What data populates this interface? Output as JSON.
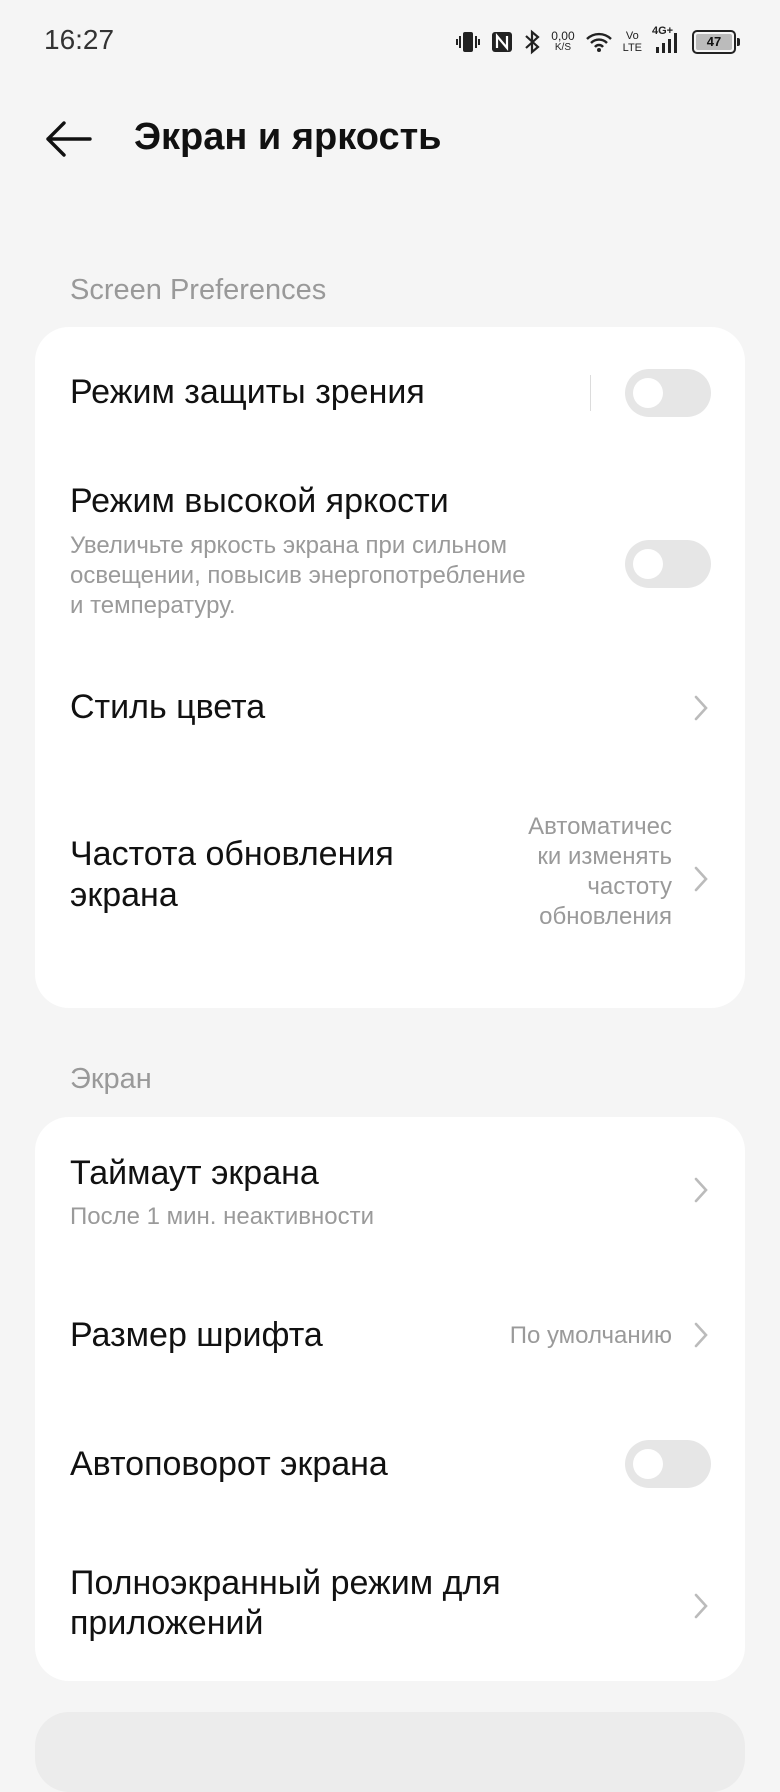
{
  "status_bar": {
    "time": "16:27",
    "net_speed_value": "0,00",
    "net_speed_unit": "K/S",
    "volte_top": "Vo",
    "volte_bottom": "LTE",
    "network_type": "4G+",
    "battery_level": "47",
    "icons": [
      "vibrate-icon",
      "nfc-icon",
      "bluetooth-icon",
      "wifi-icon",
      "signal-icon",
      "battery-icon"
    ]
  },
  "header": {
    "title": "Экран и яркость"
  },
  "sections": {
    "preferences": {
      "title": "Screen Preferences",
      "items": {
        "eye_protection": {
          "title": "Режим защиты зрения",
          "toggle": false
        },
        "high_brightness": {
          "title": "Режим высокой яркости",
          "subtitle_lines": [
            "Увеличьте яркость экрана при сильном",
            "освещении, повысив энергопотребление",
            "и температуру."
          ],
          "toggle": false
        },
        "color_style": {
          "title": "Стиль цвета"
        },
        "refresh_rate": {
          "title_lines": [
            "Частота обновления",
            "экрана"
          ],
          "value_lines": [
            "Автоматичес",
            "ки изменять",
            "частоту",
            "обновления"
          ]
        }
      }
    },
    "screen": {
      "title": "Экран",
      "items": {
        "timeout": {
          "title": "Таймаут экрана",
          "subtitle": "После 1 мин. неактивности"
        },
        "font_size": {
          "title": "Размер шрифта",
          "value": "По умолчанию"
        },
        "auto_rotate": {
          "title": "Автоповорот экрана",
          "toggle": false
        },
        "fullscreen_apps": {
          "title_lines": [
            "Полноэкранный режим для",
            "приложений"
          ]
        }
      }
    }
  },
  "colors": {
    "background": "#f5f5f5",
    "card": "#ffffff",
    "secondary_text": "#9a9a9a",
    "toggle_off": "#e6e6e6"
  }
}
